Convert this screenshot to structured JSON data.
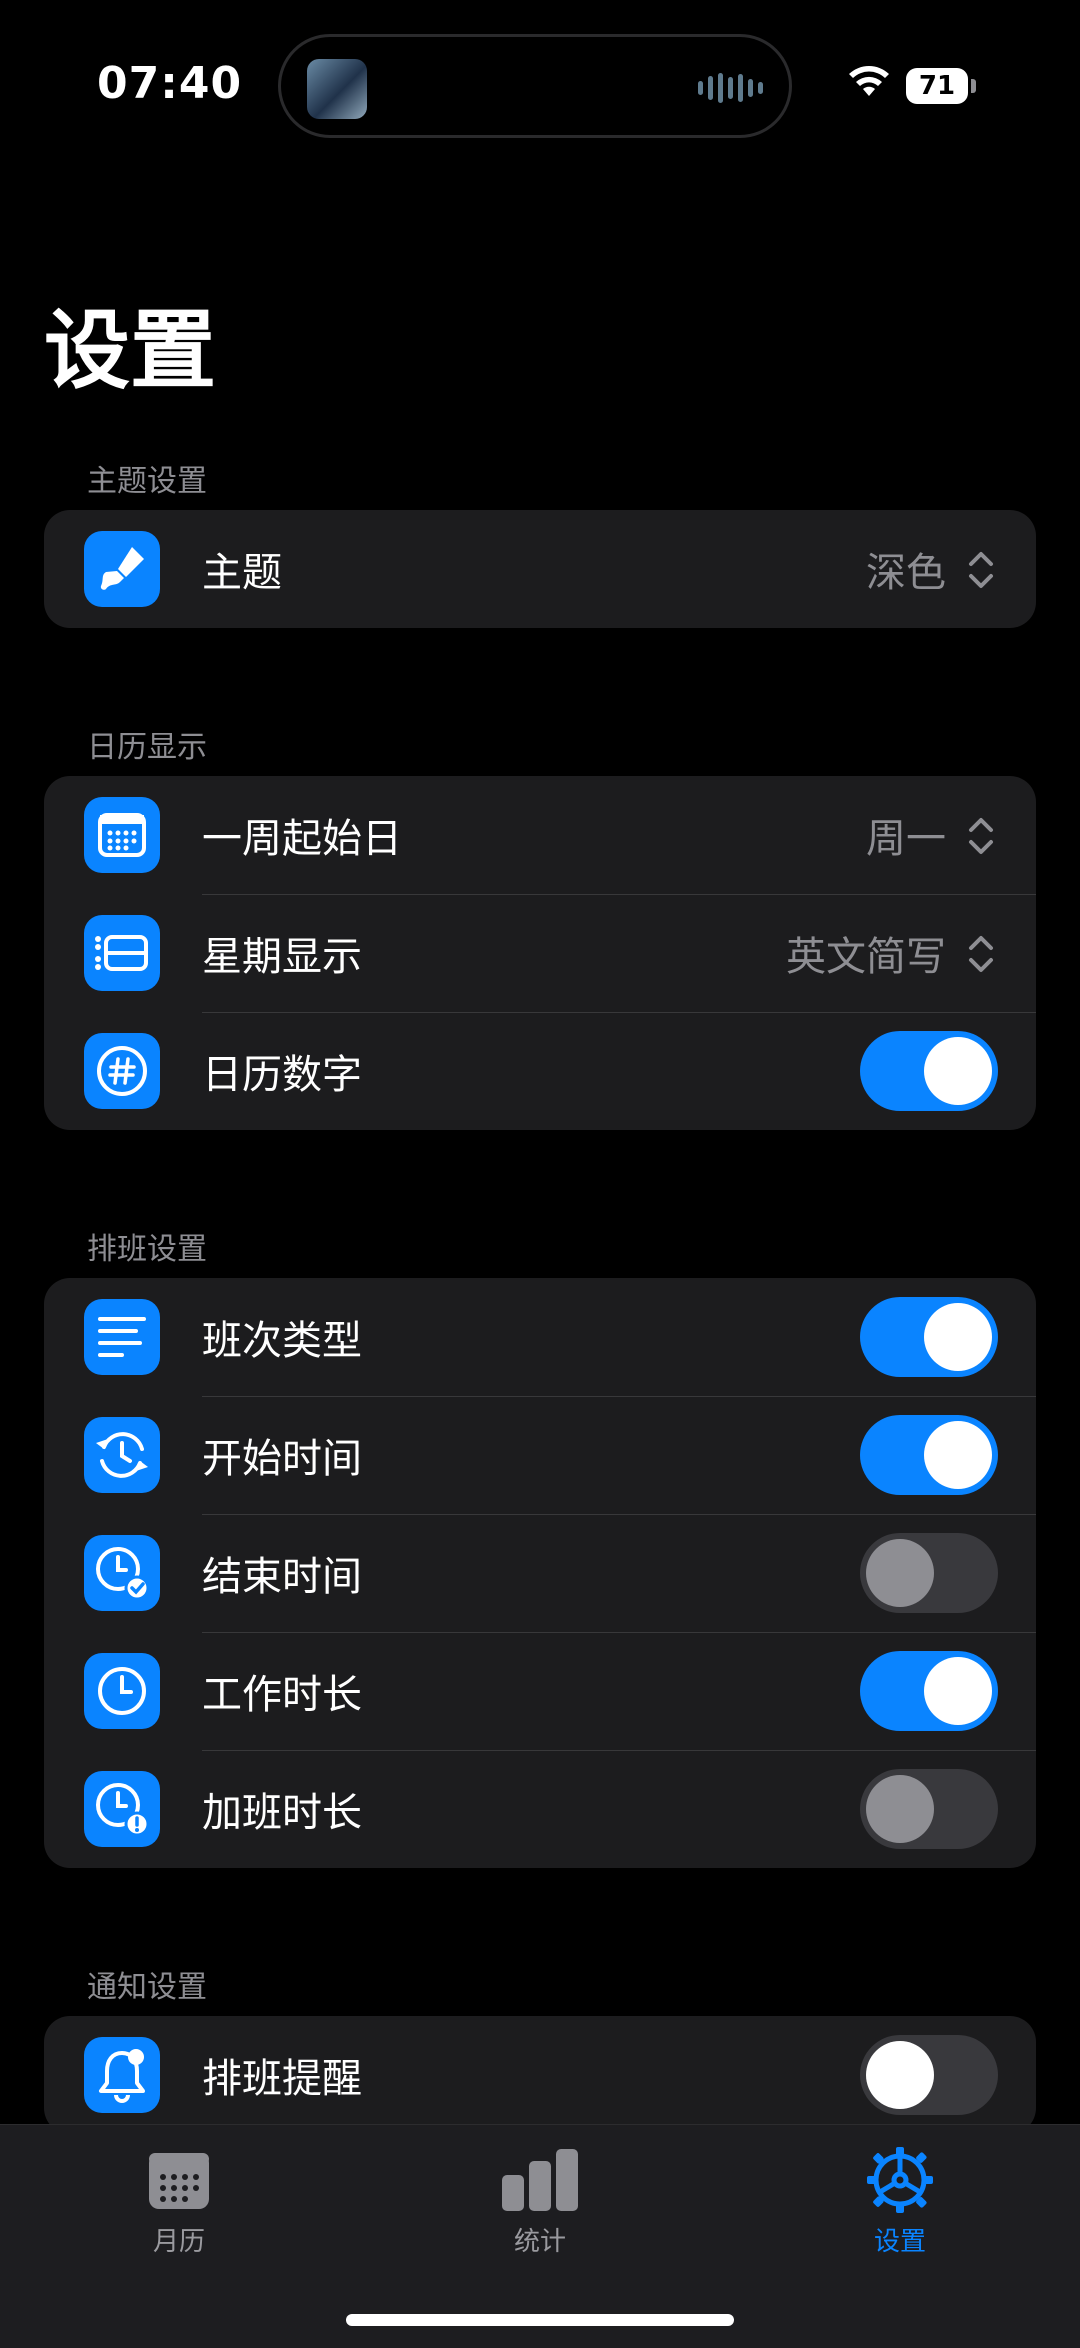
{
  "status_bar": {
    "time": "07:40",
    "battery": "71"
  },
  "page": {
    "title": "设置"
  },
  "sections": {
    "theme": {
      "header": "主题设置",
      "rows": [
        {
          "label": "主题",
          "value": "深色",
          "icon": "paintbrush-icon"
        }
      ]
    },
    "calendar": {
      "header": "日历显示",
      "rows": [
        {
          "label": "一周起始日",
          "value": "周一",
          "icon": "calendar-icon"
        },
        {
          "label": "星期显示",
          "value": "英文简写",
          "icon": "list-rectangle-icon"
        },
        {
          "label": "日历数字",
          "toggle": true,
          "icon": "number-icon"
        }
      ]
    },
    "shift": {
      "header": "排班设置",
      "rows": [
        {
          "label": "班次类型",
          "toggle": true,
          "icon": "lines-icon"
        },
        {
          "label": "开始时间",
          "toggle": true,
          "icon": "clock-arrows-icon"
        },
        {
          "label": "结束时间",
          "toggle": false,
          "icon": "clock-check-icon"
        },
        {
          "label": "工作时长",
          "toggle": true,
          "icon": "clock-icon"
        },
        {
          "label": "加班时长",
          "toggle": false,
          "icon": "clock-alert-icon"
        }
      ]
    },
    "notify": {
      "header": "通知设置",
      "rows": [
        {
          "label": "排班提醒",
          "toggle": false,
          "icon": "bell-badge-icon"
        }
      ]
    }
  },
  "tabs": [
    {
      "label": "月历",
      "icon": "calendar-grid-icon",
      "active": false
    },
    {
      "label": "统计",
      "icon": "bar-chart-icon",
      "active": false
    },
    {
      "label": "设置",
      "icon": "gear-icon",
      "active": true
    }
  ],
  "colors": {
    "accent": "#0a84ff",
    "background": "#000000",
    "group": "#1c1c1e",
    "secondary_text": "#8e8e93"
  }
}
